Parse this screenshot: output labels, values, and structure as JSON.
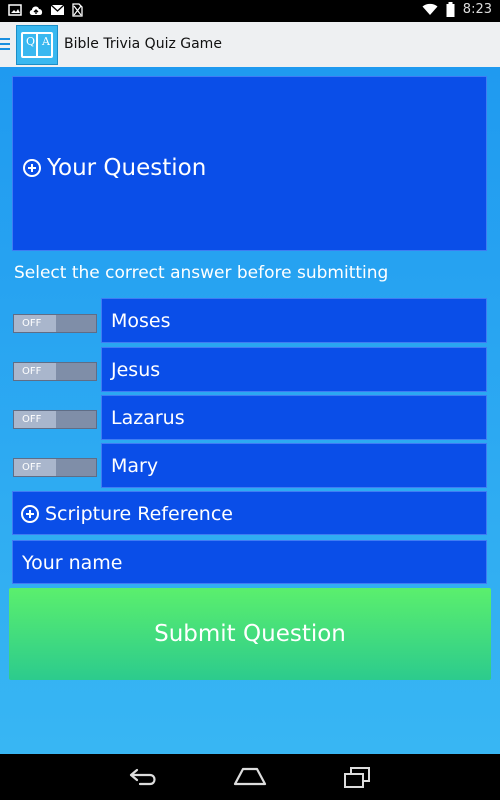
{
  "status_bar": {
    "time": "8:23"
  },
  "app_bar": {
    "title": "Bible Trivia Quiz Game",
    "logo_left": "Q",
    "logo_right": "A"
  },
  "question": {
    "placeholder": "Your Question"
  },
  "instruction": "Select the correct answer before submitting",
  "answers": [
    {
      "label": "Moses",
      "toggle": "OFF"
    },
    {
      "label": "Jesus",
      "toggle": "OFF"
    },
    {
      "label": "Lazarus",
      "toggle": "OFF"
    },
    {
      "label": "Mary",
      "toggle": "OFF"
    }
  ],
  "scripture": {
    "placeholder": "Scripture Reference"
  },
  "name": {
    "placeholder": "Your name"
  },
  "submit_label": "Submit Question",
  "colors": {
    "field_blue": "#0a4ee8",
    "background_top": "#1f9af0",
    "submit_green": "#5bef6d"
  },
  "icons": [
    "menu-icon",
    "image-icon",
    "cloud-upload-icon",
    "gmail-icon",
    "no-sim-icon",
    "wifi-icon",
    "battery-icon",
    "plus-circle-icon",
    "back-icon",
    "home-icon",
    "recents-icon"
  ]
}
